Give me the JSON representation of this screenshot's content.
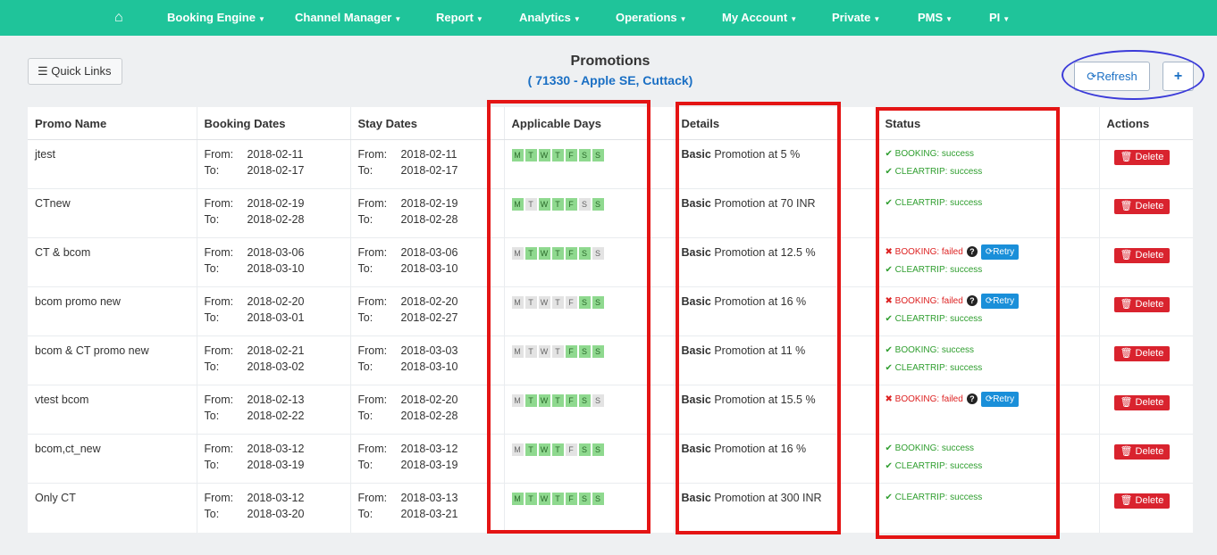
{
  "nav": {
    "home_icon": "⌂",
    "items": [
      "Booking Engine",
      "Channel Manager",
      "Report",
      "Analytics",
      "Operations",
      "My Account",
      "Private",
      "PMS",
      "PI"
    ]
  },
  "header": {
    "quick_links": "Quick Links",
    "title": "Promotions",
    "subtitle": "( 71330 - Apple SE, Cuttack)",
    "refresh": "Refresh",
    "add": "+"
  },
  "table": {
    "columns": [
      "Promo Name",
      "Booking Dates",
      "Stay Dates",
      "Applicable Days",
      "Details",
      "Status",
      "Actions"
    ],
    "day_letters": [
      "M",
      "T",
      "W",
      "T",
      "F",
      "S",
      "S"
    ],
    "from_label": "From:",
    "to_label": "To:",
    "basic_label": "Basic",
    "delete_label": "Delete",
    "retry_label": "Retry",
    "rows": [
      {
        "name": "jtest",
        "book_from": "2018-02-11",
        "book_to": "2018-02-17",
        "stay_from": "2018-02-11",
        "stay_to": "2018-02-17",
        "days": [
          1,
          1,
          1,
          1,
          1,
          1,
          1
        ],
        "detail": "Promotion at 5 %",
        "status": [
          {
            "text": "BOOKING: success",
            "ok": true
          },
          {
            "text": "CLEARTRIP: success",
            "ok": true
          }
        ]
      },
      {
        "name": "CTnew",
        "book_from": "2018-02-19",
        "book_to": "2018-02-28",
        "stay_from": "2018-02-19",
        "stay_to": "2018-02-28",
        "days": [
          1,
          0,
          1,
          1,
          1,
          0,
          1
        ],
        "detail": "Promotion at 70 INR",
        "status": [
          {
            "text": "CLEARTRIP: success",
            "ok": true
          }
        ]
      },
      {
        "name": "CT & bcom",
        "book_from": "2018-03-06",
        "book_to": "2018-03-10",
        "stay_from": "2018-03-06",
        "stay_to": "2018-03-10",
        "days": [
          0,
          1,
          1,
          1,
          1,
          1,
          0
        ],
        "detail": "Promotion at 12.5 %",
        "status": [
          {
            "text": "BOOKING: failed",
            "ok": false
          },
          {
            "text": "CLEARTRIP: success",
            "ok": true
          }
        ]
      },
      {
        "name": "bcom promo new",
        "book_from": "2018-02-20",
        "book_to": "2018-03-01",
        "stay_from": "2018-02-20",
        "stay_to": "2018-02-27",
        "days": [
          0,
          0,
          0,
          0,
          0,
          1,
          1
        ],
        "detail": "Promotion at 16 %",
        "status": [
          {
            "text": "BOOKING: failed",
            "ok": false
          },
          {
            "text": "CLEARTRIP: success",
            "ok": true
          }
        ]
      },
      {
        "name": "bcom & CT promo new",
        "book_from": "2018-02-21",
        "book_to": "2018-03-02",
        "stay_from": "2018-03-03",
        "stay_to": "2018-03-10",
        "days": [
          0,
          0,
          0,
          0,
          1,
          1,
          1
        ],
        "detail": "Promotion at 11 %",
        "status": [
          {
            "text": "BOOKING: success",
            "ok": true
          },
          {
            "text": "CLEARTRIP: success",
            "ok": true
          }
        ]
      },
      {
        "name": "vtest bcom",
        "book_from": "2018-02-13",
        "book_to": "2018-02-22",
        "stay_from": "2018-02-20",
        "stay_to": "2018-02-28",
        "days": [
          0,
          1,
          1,
          1,
          1,
          1,
          0
        ],
        "detail": "Promotion at 15.5 %",
        "status": [
          {
            "text": "BOOKING: failed",
            "ok": false
          }
        ]
      },
      {
        "name": "bcom,ct_new",
        "book_from": "2018-03-12",
        "book_to": "2018-03-19",
        "stay_from": "2018-03-12",
        "stay_to": "2018-03-19",
        "days": [
          0,
          1,
          1,
          1,
          0,
          1,
          1
        ],
        "detail": "Promotion at 16 %",
        "status": [
          {
            "text": "BOOKING: success",
            "ok": true
          },
          {
            "text": "CLEARTRIP: success",
            "ok": true
          }
        ]
      },
      {
        "name": "Only CT",
        "book_from": "2018-03-12",
        "book_to": "2018-03-20",
        "stay_from": "2018-03-13",
        "stay_to": "2018-03-21",
        "days": [
          1,
          1,
          1,
          1,
          1,
          1,
          1
        ],
        "detail": "Promotion at 300 INR",
        "status": [
          {
            "text": "CLEARTRIP: success",
            "ok": true
          }
        ]
      }
    ]
  },
  "colors": {
    "nav": "#1fc49a",
    "accent": "#1a6fc4",
    "success": "#2f9e2f",
    "danger": "#d9232e",
    "highlight": "#e41414",
    "oval": "#3b3bd9"
  }
}
